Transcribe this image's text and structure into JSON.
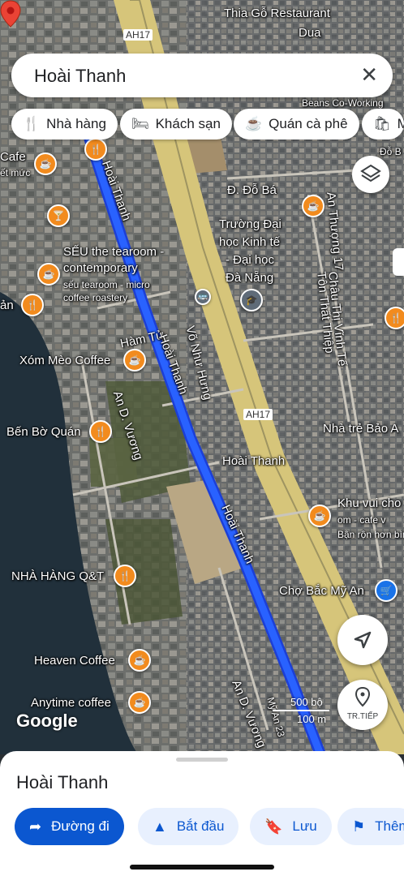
{
  "search": {
    "query": "Hoài Thanh",
    "clear_icon": "close-icon"
  },
  "chips": [
    {
      "icon": "restaurant-icon",
      "label": "Nhà hàng"
    },
    {
      "icon": "hotel-icon",
      "label": "Khách sạn"
    },
    {
      "icon": "coffee-icon",
      "label": "Quán cà phê"
    },
    {
      "icon": "shopping-icon",
      "label": "M"
    }
  ],
  "map": {
    "highway_shield": "AH17",
    "highway_shield_2": "AH17",
    "labels": {
      "thia_go": "Thia Gỗ Restaurant",
      "dua": "Dua",
      "beans": "Beans Co-Working",
      "cafe_left": "Cafe",
      "cafe_left_sub": "ết mức",
      "do_ba": "Đ. Đỗ Bá",
      "do_b_right": "Đỗ B",
      "truong1": "Trường Đại",
      "truong2": "học Kinh tế",
      "truong3": "- Đại học",
      "truong4": "Đà Nẵng",
      "seu1": "SẾU the tearoom -",
      "seu2": "contemporary",
      "seu3": "sếu tearoom - micro",
      "seu4": "coffee roastery",
      "an_left": "ản",
      "ham_tu": "Hàm Tử",
      "xom_meo": "Xóm Mèo Coffee",
      "ben_bo": "Bến Bờ Quán",
      "an_duong_vuong": "An D. Vương",
      "an_duong_vuong_2": "An D. Vương",
      "vo_nhu_hung": "Võ Như Hưng",
      "hoai_thanh_road_1": "Hoài Thanh",
      "hoai_thanh_road_2": "Hoài Thanh",
      "hoai_thanh_road_3": "Hoài Thanh",
      "hoai_thanh_pin": "Hoài Thanh",
      "an_thuong_17": "An Thượng 17",
      "chau_thi_vinh_te": "Châu Thị Vĩnh Tế",
      "ton_that_thiep": "Tôn Thất Thiệp",
      "nha_tre": "Nhà trẻ Bảo A",
      "khu_vui_choi": "Khu vui cho",
      "khu_vui_choi_sub": "om - cafe v",
      "khu_vui_choi_sub2": "Bận rộn hơn bìn",
      "nha_hang_qt": "NHÀ HÀNG Q&T",
      "cho_bac_my_an": "Chợ Bắc Mỹ An",
      "heaven": "Heaven Coffee",
      "anytime": "Anytime coffee",
      "my_an_23": "Mỹ An 23"
    },
    "google_logo": "Google",
    "scale_ft": "500 bộ",
    "scale_m": "100 m",
    "route_color": "#2962ff"
  },
  "controls": {
    "layers_icon": "layers-icon",
    "locate_icon": "navigation-arrow-icon",
    "nearby_label": "TR.TIẾP",
    "nearby_icon": "location-pin-icon"
  },
  "sheet": {
    "title": "Hoài Thanh",
    "buttons": [
      {
        "icon": "directions-icon",
        "label": "Đường đi"
      },
      {
        "icon": "navigate-icon",
        "label": "Bắt đầu"
      },
      {
        "icon": "bookmark-icon",
        "label": "Lưu"
      },
      {
        "icon": "flag-icon",
        "label": "Thêm"
      }
    ]
  }
}
